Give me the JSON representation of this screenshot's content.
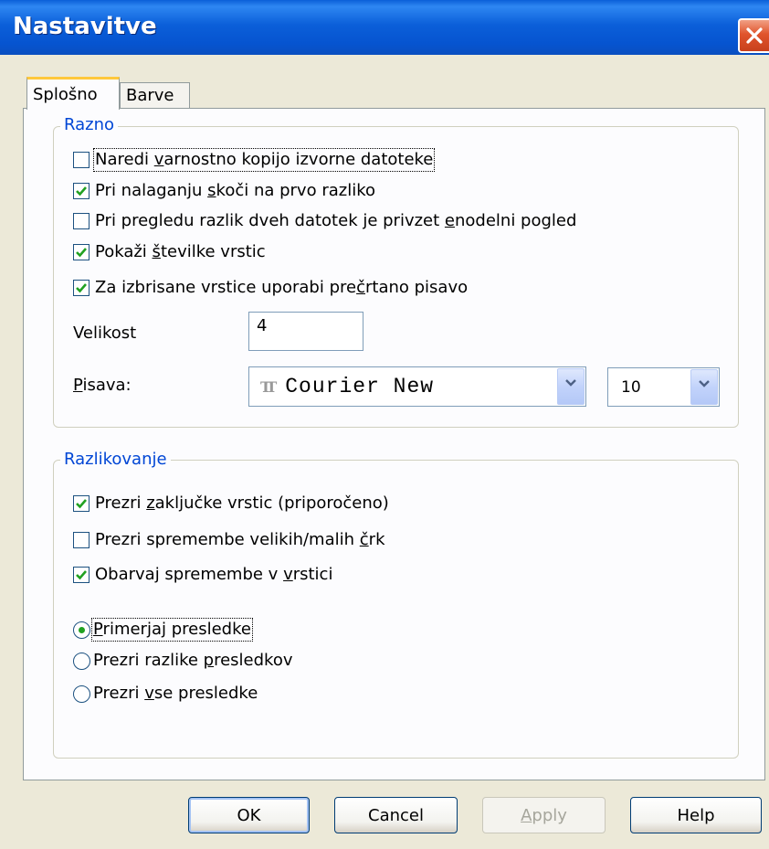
{
  "window": {
    "title": "Nastavitve"
  },
  "tabs": [
    {
      "label": "Splošno",
      "active": true
    },
    {
      "label": "Barve",
      "active": false
    }
  ],
  "razno": {
    "title": "Razno",
    "checkboxes": [
      {
        "pre": "Naredi ",
        "u": "v",
        "post": "arnostno kopijo izvorne datoteke",
        "checked": false
      },
      {
        "pre": "Pri nalaganju ",
        "u": "s",
        "post": "koči na prvo razliko",
        "checked": true
      },
      {
        "pre": "Pri pregledu razlik dveh datotek je privzet ",
        "u": "e",
        "post": "nodelni pogled",
        "checked": false
      },
      {
        "pre": "Pokaži ",
        "u": "š",
        "post": "tevilke vrstic",
        "checked": true
      },
      {
        "pre": "Za izbrisane vrstice uporabi pre",
        "u": "č",
        "post": "rtano pisavo",
        "checked": true
      }
    ],
    "velikost_label": "Velikost",
    "velikost_value": "4",
    "pisava_label_u": "P",
    "pisava_label_rest": "isava:",
    "font_icon": "TT",
    "font_value": "Courier New",
    "size_value": "10"
  },
  "razlikovanje": {
    "title": "Razlikovanje",
    "checkboxes": [
      {
        "pre": "Prezri ",
        "u": "z",
        "post": "aključke vrstic (priporočeno)",
        "checked": true
      },
      {
        "pre": "Prezri spremembe velikih/malih ",
        "u": "č",
        "post": "rk",
        "checked": false
      },
      {
        "pre": "Obarvaj spremembe v ",
        "u": "v",
        "post": "rstici",
        "checked": true
      }
    ],
    "radios": [
      {
        "pre": "",
        "u": "P",
        "post": "rimerjaj presledke",
        "selected": true
      },
      {
        "pre": "Prezri razlike ",
        "u": "p",
        "post": "resledkov",
        "selected": false
      },
      {
        "pre": "Prezri ",
        "u": "v",
        "post": "se presledke",
        "selected": false
      }
    ]
  },
  "buttons": {
    "ok": "OK",
    "cancel": "Cancel",
    "apply_u": "A",
    "apply_rest": "pply",
    "help": "Help"
  }
}
